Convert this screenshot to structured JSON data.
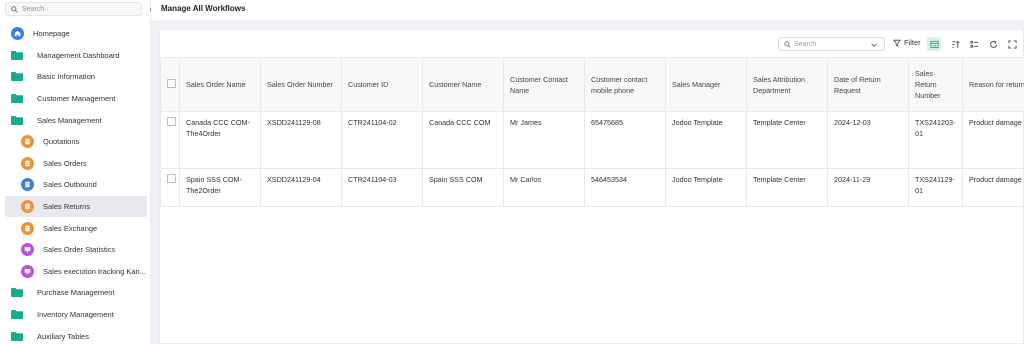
{
  "sidebar": {
    "search_placeholder": "Search",
    "collapse_glyph": "«",
    "items": [
      {
        "label": "Homepage",
        "level": "top",
        "icon": "home-icon",
        "color": "#3a7fdc"
      },
      {
        "label": "Management Dashboard",
        "level": "top",
        "icon": "folder-icon",
        "color": "#1aaa8e"
      },
      {
        "label": "Basic Information",
        "level": "top",
        "icon": "folder-icon",
        "color": "#1aaa8e"
      },
      {
        "label": "Customer Management",
        "level": "top",
        "icon": "folder-icon",
        "color": "#1aaa8e"
      },
      {
        "label": "Sales Management",
        "level": "top",
        "icon": "folder-open-icon",
        "color": "#1aaa8e"
      },
      {
        "label": "Quotations",
        "level": "child",
        "icon": "form-icon",
        "color": "#f0923b"
      },
      {
        "label": "Sales Orders",
        "level": "child",
        "icon": "form-icon",
        "color": "#f0923b"
      },
      {
        "label": "Sales Outbound",
        "level": "child",
        "icon": "form-icon",
        "color": "#3a7fdc"
      },
      {
        "label": "Sales Returns",
        "level": "child",
        "icon": "form-icon",
        "color": "#f0923b",
        "active": true
      },
      {
        "label": "Sales Exchange",
        "level": "child",
        "icon": "form-icon",
        "color": "#f0923b"
      },
      {
        "label": "Sales Order Statistics",
        "level": "child",
        "icon": "report-icon",
        "color": "#b656d6"
      },
      {
        "label": "Sales execution tracking Kan...",
        "level": "child",
        "icon": "report-icon",
        "color": "#b656d6"
      },
      {
        "label": "Purchase Management",
        "level": "top",
        "icon": "folder-icon",
        "color": "#1aaa8e"
      },
      {
        "label": "Inventory Management",
        "level": "top",
        "icon": "folder-icon",
        "color": "#1aaa8e"
      },
      {
        "label": "Auxiliary Tables",
        "level": "top",
        "icon": "folder-icon",
        "color": "#1aaa8e"
      }
    ]
  },
  "header": {
    "title": "Manage All Workflows"
  },
  "toolbar": {
    "search_placeholder": "Search",
    "filter_label": "Filter",
    "accent": "#1aaa8e"
  },
  "table": {
    "columns": [
      "Sales Order Name",
      "Sales Order Number",
      "Customer ID",
      "Customer Name",
      "Customer Contact Name",
      "Customer contact mobile phone",
      "Sales Manager",
      "Sales Attribution Department",
      "Date of Return Request",
      "Sales Return Number",
      "Reason for return"
    ],
    "rows": [
      [
        "Canada CCC COM-The4Order",
        "XSDD241129-08",
        "CTR241104-02",
        "Canada CCC COM",
        "Mr James",
        "65475685",
        "Jodoo Template",
        "Template Center",
        "2024-12-03",
        "TXS241203-01",
        "Product damage"
      ],
      [
        "Spain SSS COM-The2Order",
        "XSDD241129-04",
        "CTR241104-03",
        "Spain SSS COM",
        "Mr Carlos",
        "546453534",
        "Jodoo Template",
        "Template Center",
        "2024-11-29",
        "TXS241129-01",
        "Product damage"
      ]
    ]
  }
}
